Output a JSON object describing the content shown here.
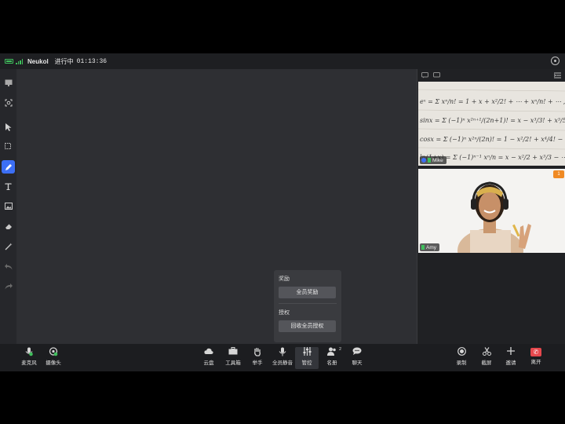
{
  "topbar": {
    "app_name": "Neukol",
    "status": "进行中",
    "timer": "01:13:36"
  },
  "toolbar": {
    "tools": [
      "whiteboard-icon",
      "scan-icon",
      "cursor-icon",
      "select-icon",
      "pen-icon",
      "text-icon",
      "image-icon",
      "eraser-icon",
      "magic-wand-icon",
      "undo-icon",
      "redo-icon"
    ],
    "active_tool": "pen-icon"
  },
  "videos": {
    "participants": [
      {
        "name": "Mike"
      },
      {
        "name": "Amy",
        "badge": "1"
      }
    ],
    "board_lines": [
      "eˣ = Σ xⁿ/n! = 1 + x + x²/2! + ⋯ + xⁿ/n! + ⋯ , x∈(−∞",
      "sinx = Σ (−1)ⁿ x²ⁿ⁺¹/(2n+1)! = x − x³/3! + x⁵/5! − ⋯ , x∈(−∞",
      "cosx = Σ (−1)ⁿ x²ⁿ/(2n)! = 1 − x²/2! + x⁴/4! − ⋯ , x∈(−∞",
      "ln(1+x) = Σ (−1)ⁿ⁻¹ xⁿ/n = x − x²/2 + x³/3 − ⋯ , x∈(−1"
    ]
  },
  "popup": {
    "reward_title": "奖励",
    "reward_all_button": "全员奖励",
    "auth_title": "授权",
    "revoke_all_button": "回收全员授权"
  },
  "bottombar": {
    "left": [
      {
        "label": "麦克风",
        "icon": "microphone-icon"
      },
      {
        "label": "摄像头",
        "icon": "camera-icon"
      }
    ],
    "center": [
      {
        "label": "云盘",
        "icon": "cloud-icon"
      },
      {
        "label": "工具箱",
        "icon": "toolbox-icon"
      },
      {
        "label": "举手",
        "icon": "raise-hand-icon"
      },
      {
        "label": "全员静音",
        "icon": "mute-all-icon"
      },
      {
        "label": "管控",
        "icon": "control-icon"
      },
      {
        "label": "名册",
        "icon": "roster-icon",
        "count": "2"
      },
      {
        "label": "聊天",
        "icon": "chat-icon"
      }
    ],
    "right": [
      {
        "label": "录制",
        "icon": "record-icon"
      },
      {
        "label": "截屏",
        "icon": "screenshot-icon"
      },
      {
        "label": "邀请",
        "icon": "invite-icon"
      },
      {
        "label": "离开",
        "icon": "leave-icon"
      }
    ]
  },
  "colors": {
    "accent": "#3c6ff5",
    "leave": "#e5484d",
    "signal": "#3fbf5c",
    "badge": "#f08a24"
  }
}
